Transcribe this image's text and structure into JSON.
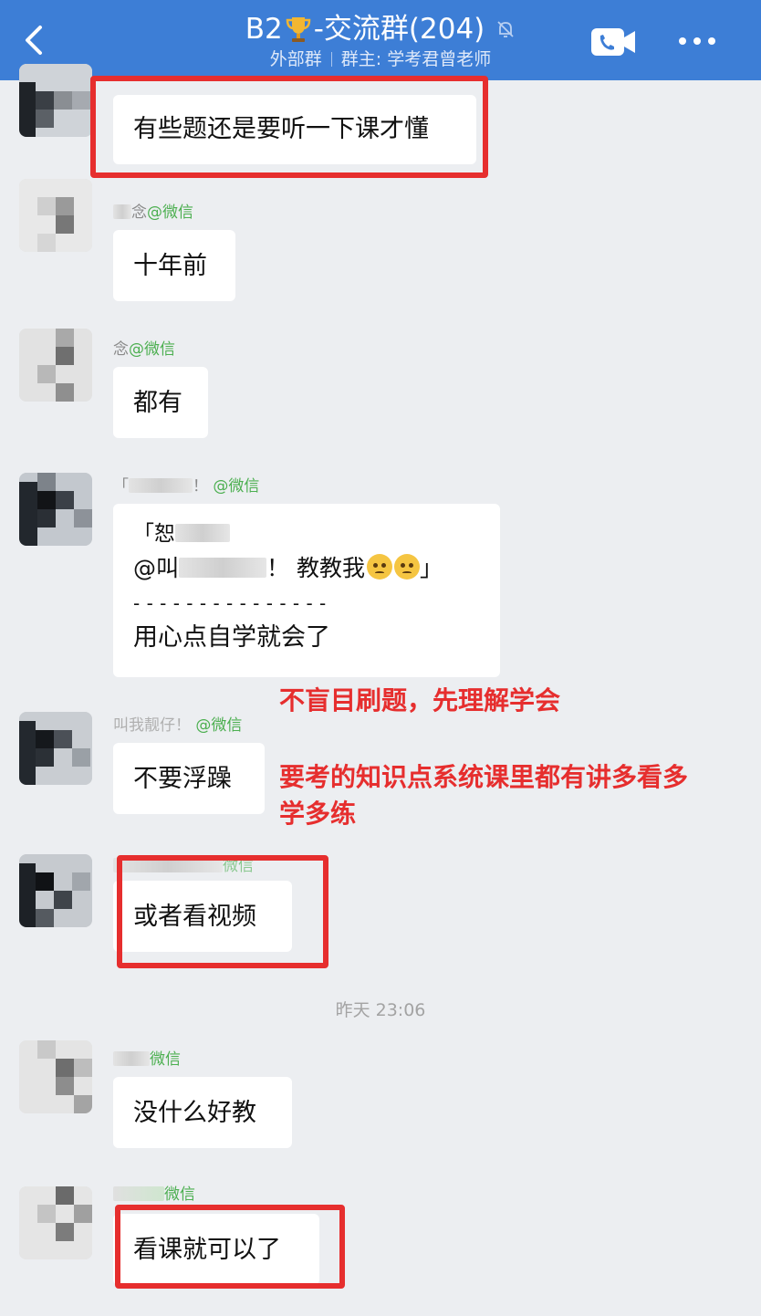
{
  "header": {
    "title_prefix": "B2",
    "title_suffix": "-交流群(204)",
    "scope": "外部群",
    "owner": "群主: 学考君曾老师",
    "bg_color": "#3d7ed6"
  },
  "messages": [
    {
      "text": "有些题还是要听一下课才懂"
    },
    {
      "sender": "念",
      "source": "@微信",
      "text": "十年前"
    },
    {
      "sender": "念",
      "source": "@微信",
      "text": "都有"
    },
    {
      "sender_a": "「",
      "sender_b": "！",
      "source": "@微信",
      "quote_line1": "「恕",
      "quote_line2a": "@叫",
      "quote_line2b": "！ 教教我",
      "quote_line2c": "」",
      "divider": "- - - - - - - - - - - - - - -",
      "text": "用心点自学就会了"
    },
    {
      "sender": "叫我靓仔！",
      "source": "@微信",
      "text": "不要浮躁"
    },
    {
      "source": "微信",
      "text": "或者看视频"
    },
    {
      "source": "微信",
      "text": "没什么好教"
    },
    {
      "source": "微信",
      "text": "看课就可以了"
    }
  ],
  "timestamp": "昨天 23:06",
  "annotations": {
    "note1": "不盲目刷题，先理解学会",
    "note2_line1": "要考的知识点系统课里都有讲多看多",
    "note2_line2": "学多练",
    "color": "#e62e2e"
  }
}
